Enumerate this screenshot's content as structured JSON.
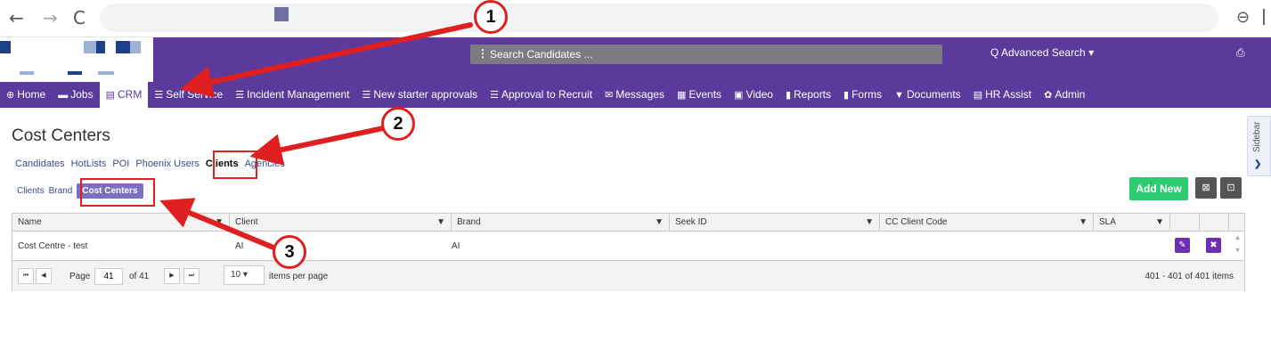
{
  "browser": {
    "back_icon": "←",
    "forward_icon": "→",
    "reload_icon": "C",
    "zoom_icon": "⊖"
  },
  "header": {
    "search_placeholder": "Search Candidates ...",
    "search_menu_icon": "⋮",
    "advanced_search": "Q Advanced Search ▾",
    "print_icon": "⎙"
  },
  "nav": {
    "items": [
      {
        "icon": "⊕",
        "label": "Home"
      },
      {
        "icon": "▬",
        "label": "Jobs"
      },
      {
        "icon": "▤",
        "label": "CRM",
        "active": true
      },
      {
        "icon": "☰",
        "label": "Self Service"
      },
      {
        "icon": "☰",
        "label": "Incident Management"
      },
      {
        "icon": "☰",
        "label": "New starter approvals"
      },
      {
        "icon": "☰",
        "label": "Approval to Recruit"
      },
      {
        "icon": "✉",
        "label": "Messages"
      },
      {
        "icon": "▦",
        "label": "Events"
      },
      {
        "icon": "▣",
        "label": "Video"
      },
      {
        "icon": "▮",
        "label": "Reports"
      },
      {
        "icon": "▮",
        "label": "Forms"
      },
      {
        "icon": "▼",
        "label": "Documents"
      },
      {
        "icon": "▤",
        "label": "HR Assist"
      },
      {
        "icon": "✿",
        "label": "Admin"
      }
    ]
  },
  "page": {
    "title": "Cost Centers",
    "tabs": [
      "Candidates",
      "HotLists",
      "POI",
      "Phoenix Users",
      "Clients",
      "Agencies"
    ],
    "active_tab": "Clients",
    "subtabs": [
      "Clients",
      "Brand",
      "Cost Centers"
    ],
    "active_subtab": "Cost Centers",
    "add_new": "Add New",
    "export_excel_icon": "⊠",
    "export_pdf_icon": "⊡"
  },
  "grid": {
    "columns": [
      "Name",
      "Client",
      "Brand",
      "Seek ID",
      "CC Client Code",
      "SLA"
    ],
    "filter_icon": "▼",
    "rows": [
      {
        "name": "Cost Centre - test",
        "client": "AI",
        "brand": "AI",
        "seek_id": "",
        "cc_client_code": "",
        "sla": ""
      }
    ],
    "edit_icon": "✎",
    "delete_icon": "✖",
    "pager": {
      "first_icon": "⏮",
      "prev_icon": "◀",
      "next_icon": "▶",
      "last_icon": "⏭",
      "page_label": "Page",
      "page_value": "41",
      "of_label": "of 41",
      "per_page_value": "10 ▾",
      "per_page_label": "items per page",
      "summary": "401 - 401 of 401 items"
    }
  },
  "sidebar": {
    "label": "Sidebar",
    "chevron": "❯"
  },
  "annotations": {
    "badges": [
      "1",
      "2",
      "3"
    ],
    "color": "#e02020"
  }
}
